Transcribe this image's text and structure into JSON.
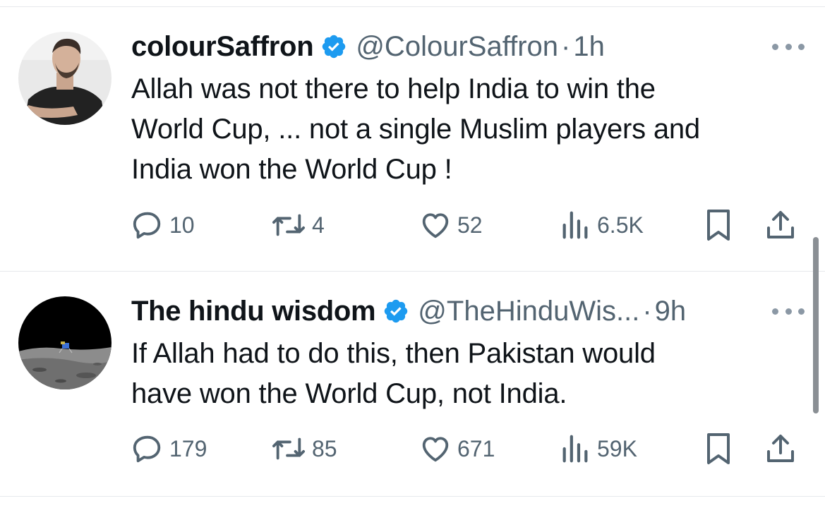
{
  "tweets": [
    {
      "display_name": "colourSaffron",
      "verified": true,
      "handle": "@ColourSaffron",
      "separator": "·",
      "time": "1h",
      "text_lines": [
        "Allah was not there to help India to win the",
        "World Cup, ... not a single Muslim players and",
        "India won the World Cup !"
      ],
      "replies": "10",
      "reposts": "4",
      "likes": "52",
      "views": "6.5K",
      "icons": [
        "reply-icon",
        "repost-icon",
        "like-icon",
        "views-icon",
        "bookmark-icon",
        "share-icon",
        "more-icon"
      ]
    },
    {
      "display_name": "The hindu wisdom",
      "verified": true,
      "handle": "@TheHinduWis...",
      "separator": "·",
      "time": "9h",
      "text_lines": [
        "If Allah had to do this, then Pakistan would",
        "have won the World Cup, not India."
      ],
      "replies": "179",
      "reposts": "85",
      "likes": "671",
      "views": "59K",
      "icons": [
        "reply-icon",
        "repost-icon",
        "like-icon",
        "views-icon",
        "bookmark-icon",
        "share-icon",
        "more-icon"
      ]
    }
  ],
  "colors": {
    "text": "#0f1419",
    "secondary": "#536471",
    "verified": "#1d9bf0",
    "divider": "#e6e9ec"
  }
}
